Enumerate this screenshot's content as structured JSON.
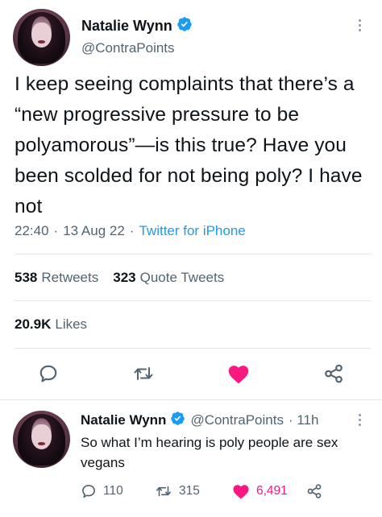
{
  "main_tweet": {
    "author_name": "Natalie Wynn",
    "author_handle": "@ContraPoints",
    "text": "I keep seeing complaints that there’s a “new progressive pressure to be polyamorous”—is this true? Have you been scolded for not being poly? I have not",
    "time": "22:40",
    "date": "13 Aug 22",
    "source": "Twitter for iPhone",
    "separator": "·",
    "retweets_count": "538",
    "retweets_label": "Retweets",
    "quote_count": "323",
    "quote_label": "Quote Tweets",
    "likes_count": "20.9K",
    "likes_label": "Likes",
    "liked": true
  },
  "reply": {
    "author_name": "Natalie Wynn",
    "author_handle": "@ContraPoints",
    "age": "· 11h",
    "text": "So what I’m hearing is poly people are sex vegans",
    "reply_count": "110",
    "retweet_count": "315",
    "like_count": "6,491",
    "liked": true
  },
  "colors": {
    "accent": "#1d9bf0",
    "like": "#f91880",
    "text": "#0f1419",
    "secondary": "#536471",
    "divider": "#e1e6ea"
  },
  "icons": [
    "verified-badge-icon",
    "more-icon",
    "reply-icon",
    "retweet-icon",
    "heart-icon",
    "share-icon"
  ]
}
